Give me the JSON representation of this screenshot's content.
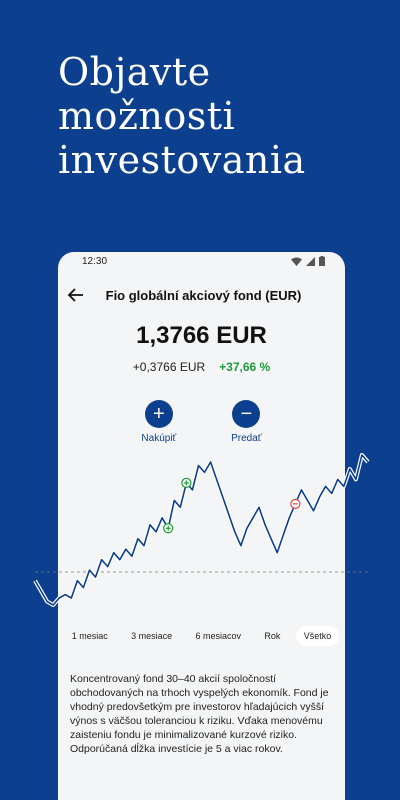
{
  "headline": {
    "line1": "Objavte",
    "line2": "možnosti",
    "line3": "investovania"
  },
  "status": {
    "time": "12:30"
  },
  "header": {
    "title": "Fio globální akciový fond (EUR)"
  },
  "fund": {
    "price": "1,3766 EUR",
    "change_abs": "+0,3766 EUR",
    "change_pct": "+37,66 %"
  },
  "actions": {
    "buy": "Nakúpiť",
    "sell": "Predať"
  },
  "periods": [
    "1 mesiac",
    "3 mesiace",
    "6 mesiacov",
    "Rok",
    "Všetko"
  ],
  "selected_period": "Všetko",
  "description": "Koncentrovaný fond 30–40 akcií spoločností obchodovaných na trhoch vyspelých ekonomík. Fond je vhodný predovšetkým pre investorov hľadajúcich vyšší výnos s väčšou toleranciou k riziku. Vďaka menovému zaisteniu fondu je minimalizované kurzové riziko. Odporúčaná dĺžka investície je 5 a viac rokov.",
  "colors": {
    "brand_blue": "#0d3f8f",
    "positive_green": "#1f9a3a",
    "sell_marker": "#d94a4a"
  },
  "chart_data": {
    "type": "line",
    "baseline": 1.0,
    "values": [
      1.02,
      0.99,
      0.96,
      0.95,
      0.97,
      0.98,
      0.97,
      1.02,
      1.0,
      1.05,
      1.03,
      1.08,
      1.06,
      1.1,
      1.08,
      1.11,
      1.09,
      1.14,
      1.12,
      1.18,
      1.16,
      1.2,
      1.17,
      1.25,
      1.23,
      1.3,
      1.28,
      1.35,
      1.33,
      1.36,
      1.31,
      1.26,
      1.21,
      1.16,
      1.12,
      1.17,
      1.2,
      1.23,
      1.18,
      1.14,
      1.1,
      1.15,
      1.2,
      1.24,
      1.28,
      1.25,
      1.22,
      1.26,
      1.29,
      1.27,
      1.31,
      1.29,
      1.34,
      1.31,
      1.38,
      1.36
    ],
    "buy_markers": [
      22,
      25
    ],
    "sell_markers": [
      43
    ]
  }
}
